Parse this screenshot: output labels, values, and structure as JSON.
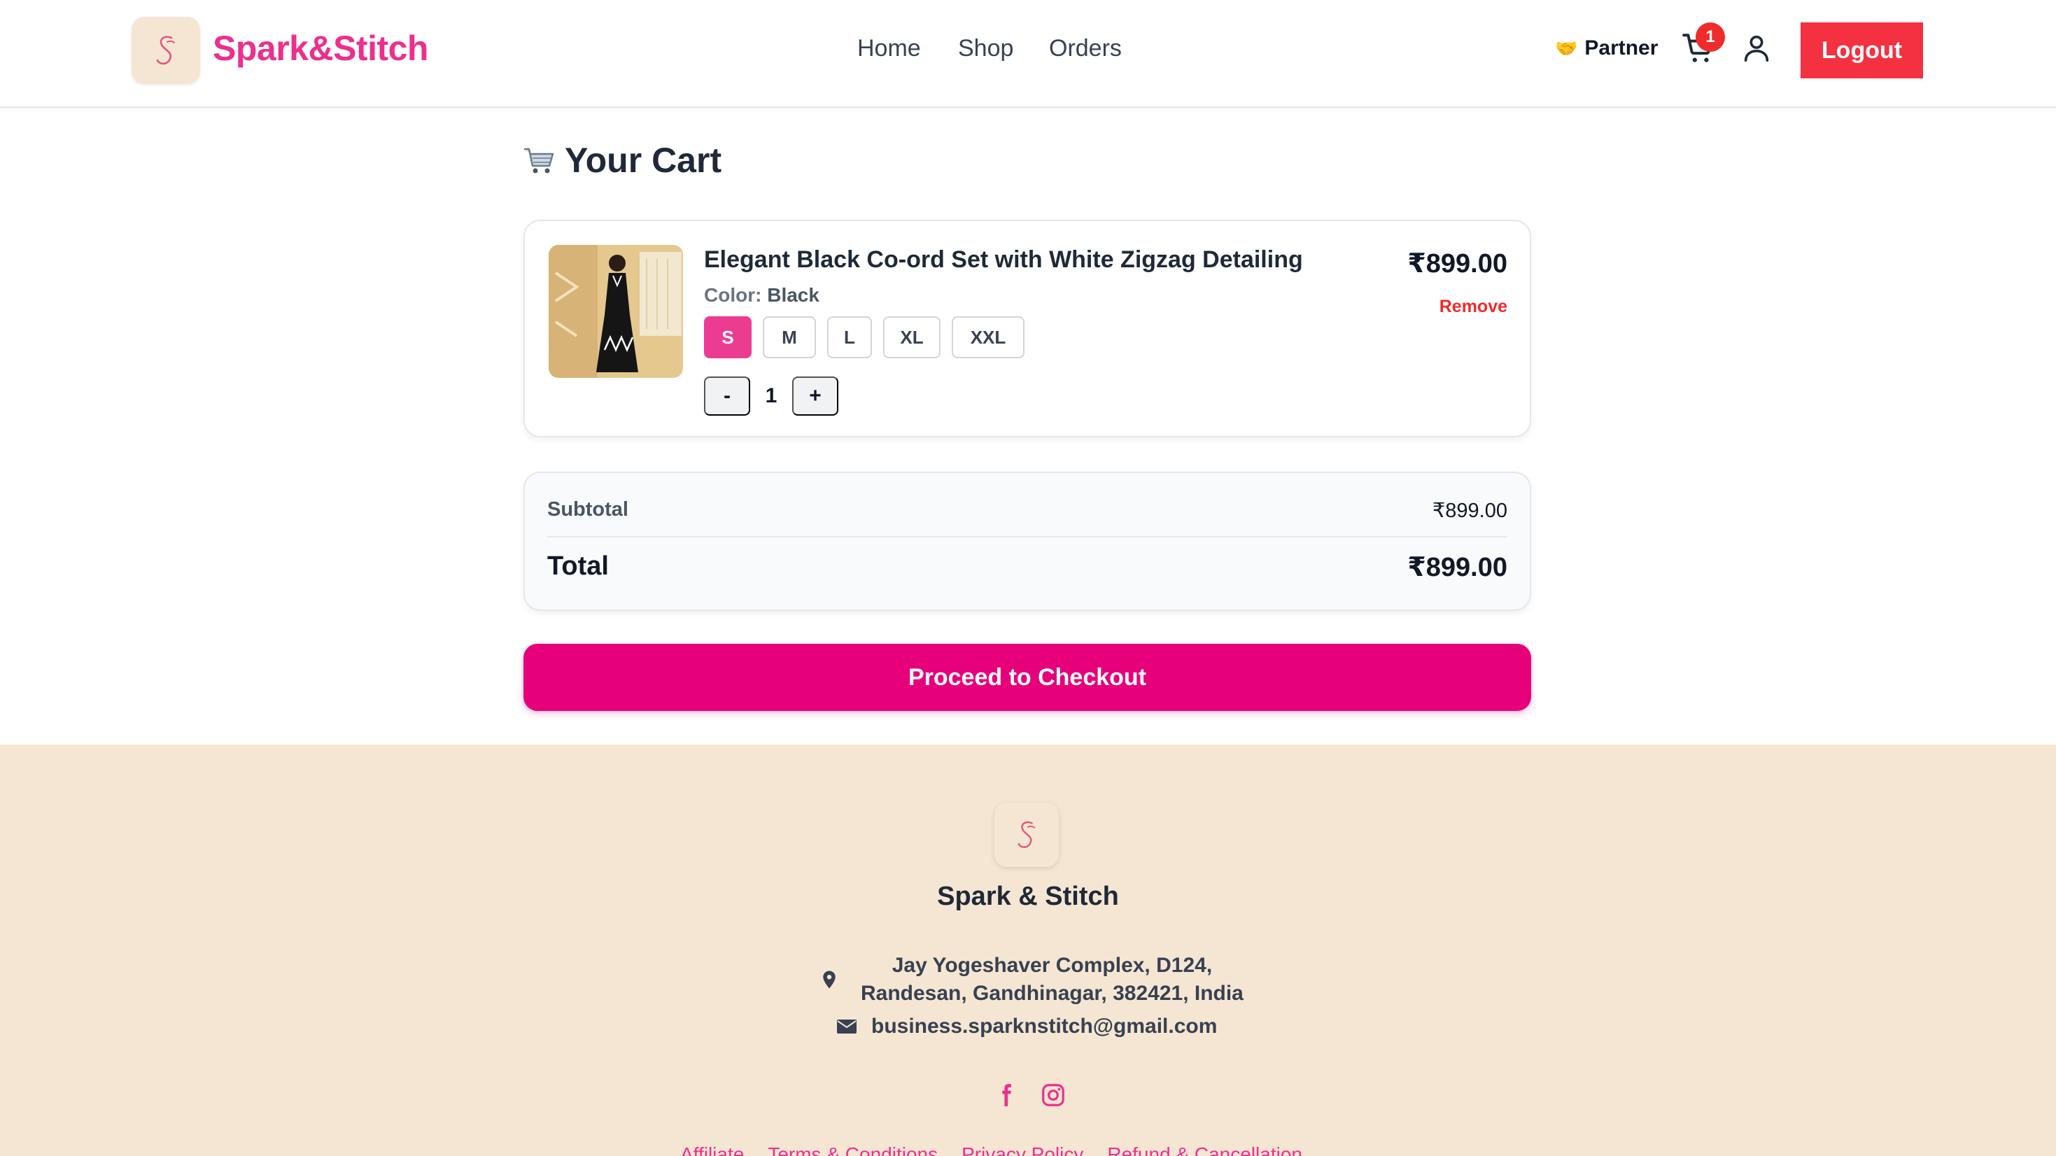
{
  "brand": {
    "name": "Spark&Stitch",
    "logo_letter": "S"
  },
  "nav": {
    "home": "Home",
    "shop": "Shop",
    "orders": "Orders"
  },
  "header_actions": {
    "partner_icon": "🤝",
    "partner_label": "Partner",
    "cart_count": "1",
    "logout_label": "Logout"
  },
  "cart": {
    "title_icon": "🛒",
    "title": "Your Cart",
    "item": {
      "name": "Elegant Black Co-ord Set with White Zigzag Detailing",
      "price": "₹899.00",
      "remove_label": "Remove",
      "color_label": "Color:",
      "color_value": "Black",
      "sizes": [
        "S",
        "M",
        "L",
        "XL",
        "XXL"
      ],
      "selected_size": "S",
      "quantity": "1",
      "qty_minus": "-",
      "qty_plus": "+"
    },
    "summary": {
      "subtotal_label": "Subtotal",
      "subtotal_value": "₹899.00",
      "total_label": "Total",
      "total_value": "₹899.00"
    },
    "checkout_label": "Proceed to Checkout"
  },
  "footer": {
    "brand": "Spark & Stitch",
    "address_line1": "Jay Yogeshaver Complex, D124,",
    "address_line2": "Randesan, Gandhinagar, 382421, India",
    "email": "business.sparknstitch@gmail.com",
    "links": [
      "Affiliate",
      "Terms & Conditions",
      "Privacy Policy",
      "Refund & Cancellation"
    ]
  },
  "colors": {
    "brand_pink": "#ec2f8f",
    "checkout_pink": "#e6007a",
    "logout_red": "#f43141",
    "footer_bg": "#f5e6d3"
  }
}
